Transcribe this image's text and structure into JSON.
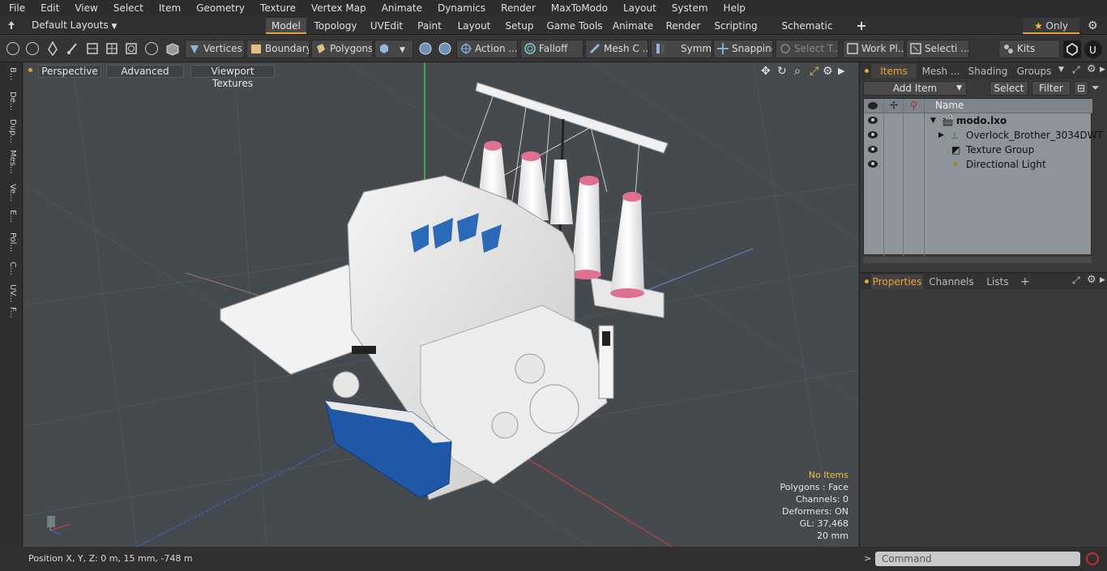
{
  "menu": [
    "File",
    "Edit",
    "View",
    "Select",
    "Item",
    "Geometry",
    "Texture",
    "Vertex Map",
    "Animate",
    "Dynamics",
    "Render",
    "MaxToModo",
    "Layout",
    "System",
    "Help"
  ],
  "layout_bar": {
    "layout_dropdown": "Default Layouts",
    "tabs": [
      "Model",
      "Topology",
      "UVEdit",
      "Paint",
      "Layout",
      "Setup",
      "Game Tools",
      "Animate",
      "Render",
      "Scripting",
      "Schematic Fusion"
    ],
    "active_tab": "Model",
    "add_tab": "+",
    "only_label": "Only"
  },
  "toolbar": {
    "vertices": "Vertices",
    "boundary": "Boundary",
    "polygons": "Polygons",
    "action": "Action ...",
    "falloff": "Falloff",
    "mesh_constraints": "Mesh C ...",
    "symmetry": "Symm ...",
    "snapping": "Snapping",
    "select_through": "Select T...",
    "work_plane": "Work Pl...",
    "selection_sets": "Selecti ...",
    "kits": "Kits"
  },
  "left_strip": [
    "B...",
    "De...",
    "Dup...",
    "Mes...",
    "Ve...",
    "E...",
    "Pol...",
    "C...",
    "UV...",
    "F..."
  ],
  "viewport": {
    "view_mode": "Perspective",
    "advanced": "Advanced",
    "textures": "Viewport Textures",
    "stats": {
      "selection": "No Items",
      "polygons": "Polygons : Face",
      "channels": "Channels: 0",
      "deformers": "Deformers: ON",
      "gl": "GL: 37,468",
      "grid": "20 mm"
    },
    "colors": {
      "selection": "#f0c040",
      "axis_x": "#d04040",
      "axis_y": "#40c040",
      "axis_z": "#4060d0"
    }
  },
  "status": {
    "position": "Position X, Y, Z:  0 m, 15 mm, -748 m"
  },
  "items_panel": {
    "tabs": [
      "Items",
      "Mesh ...",
      "Shading",
      "Groups"
    ],
    "active_tab": "Items",
    "add_item": "Add Item",
    "select": "Select",
    "filter": "Filter",
    "name_header": "Name",
    "rows": [
      {
        "label": "modo.lxo"
      },
      {
        "label": "Overlock_Brother_3034DWT"
      },
      {
        "label": "Texture Group"
      },
      {
        "label": "Directional Light"
      }
    ]
  },
  "properties_panel": {
    "tabs": [
      "Properties",
      "Channels",
      "Lists"
    ],
    "active_tab": "Properties",
    "add": "+"
  },
  "command": {
    "placeholder": "Command"
  }
}
